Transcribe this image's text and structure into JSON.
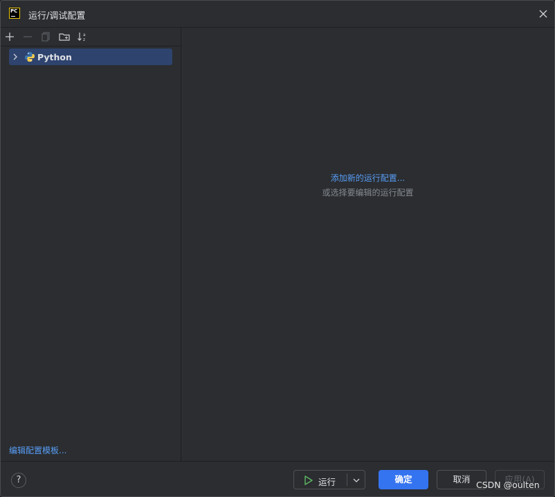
{
  "window": {
    "title": "运行/调试配置"
  },
  "toolbar": {
    "add_icon": "plus-icon",
    "remove_icon": "minus-icon",
    "copy_icon": "copy-icon",
    "folder_icon": "new-folder-icon",
    "sort_icon": "sort-alpha-icon"
  },
  "tree": {
    "items": [
      {
        "label": "Python",
        "icon": "python-icon",
        "expanded": false,
        "selected": true
      }
    ]
  },
  "left_footer": {
    "templates_link": "编辑配置模板..."
  },
  "main": {
    "add_link": "添加新的运行配置...",
    "hint": "或选择要编辑的运行配置"
  },
  "footer": {
    "help": "?",
    "run_label": "运行",
    "ok_label": "确定",
    "cancel_label": "取消",
    "apply_label": "应用(A)"
  },
  "watermark": "CSDN @oulten",
  "colors": {
    "accent": "#3574f0",
    "link": "#589df6",
    "selection": "#2e436e",
    "background": "#2b2d30"
  }
}
